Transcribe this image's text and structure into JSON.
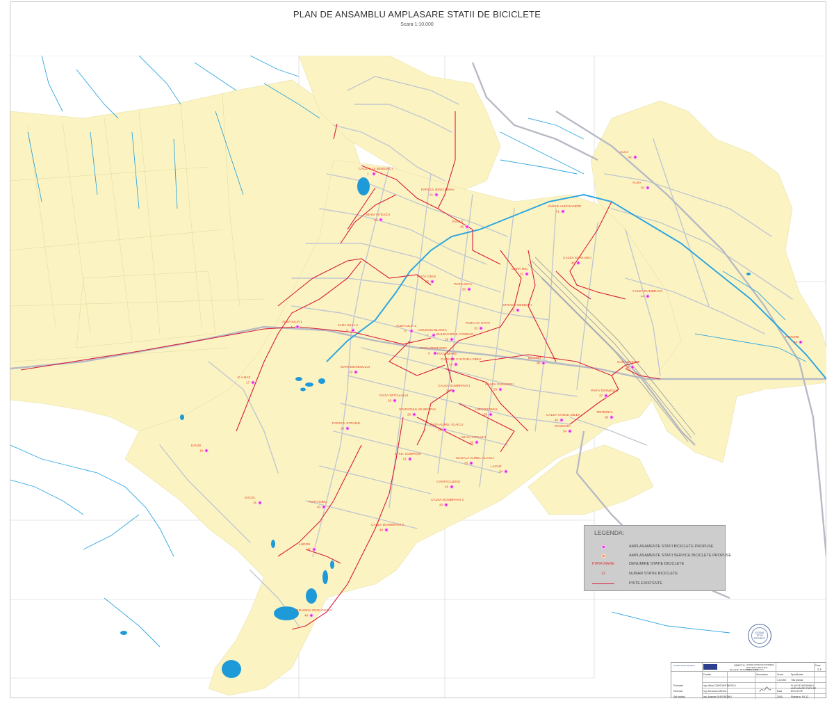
{
  "header": {
    "title": "PLAN DE ANSAMBLU AMPLASARE STATII DE BICICLETE",
    "scale": "Scara 1:10.000"
  },
  "colors": {
    "urban_area": "#fbf4c2",
    "roads": "#c2c6d0",
    "rivers": "#2fa6e0",
    "lakes": "#1e9ad8",
    "bike_lanes": "#d81b3a",
    "station_marker": "#e81ce0",
    "station_label": "#e8402a"
  },
  "stations": [
    {
      "name": "CALEA LUI BENEDICT",
      "number": "1"
    },
    {
      "name": "PARCUL BRUCKMAN",
      "number": "21"
    },
    {
      "name": "MIHAI VITEAZU",
      "number": "22"
    },
    {
      "name": "VASILE",
      "number": "26"
    },
    {
      "name": "PIATA CIBIN",
      "number": "27"
    },
    {
      "name": "PIATA MICA",
      "number": "30"
    },
    {
      "name": "GARA MIC",
      "number": "31"
    },
    {
      "name": "ALBA IULIA 2",
      "number": "3"
    },
    {
      "name": "ALBA IULIA 1",
      "number": "4"
    },
    {
      "name": "ALBA IULIA 3",
      "number": "5"
    },
    {
      "name": "COLEGIU BLOGIA",
      "number": "7"
    },
    {
      "name": "PIATA MARE",
      "number": "8"
    },
    {
      "name": "BULEVARDUL COSBUC",
      "number": "29"
    },
    {
      "name": "PIATA PRIMARIEI",
      "number": "9"
    },
    {
      "name": "CASA DE CULTURA SIBIU",
      "number": "14"
    },
    {
      "name": "PARC AC STATI",
      "number": "33"
    },
    {
      "name": "STRADA OBINETH",
      "number": "25"
    },
    {
      "name": "E.A.BAZ",
      "number": "17"
    },
    {
      "name": "MARAMURESULUI",
      "number": "16"
    },
    {
      "name": "PIATA SPITALULUI",
      "number": "28"
    },
    {
      "name": "CALEA DUMBRAVII 1",
      "number": "36"
    },
    {
      "name": "STADIONUL MUNICIPAL",
      "number": "20"
    },
    {
      "name": "HIPODROMUL",
      "number": "39"
    },
    {
      "name": "PIATA AUREL VLAICU",
      "number": "31"
    },
    {
      "name": "PARCUL STRAND",
      "number": "18"
    },
    {
      "name": "MIHAI VITEAZU",
      "number": "32"
    },
    {
      "name": "SCOALA AUREL VLAICU",
      "number": "35"
    },
    {
      "name": "DAVID",
      "number": "19"
    },
    {
      "name": "LAZAR",
      "number": "34"
    },
    {
      "name": "BILSTEF",
      "number": "36"
    },
    {
      "name": "CALEA VASILE MILEA",
      "number": "40"
    },
    {
      "name": "PIATA SIBIU",
      "number": "40"
    },
    {
      "name": "CALEA DUMBRAVII 2",
      "number": "48"
    },
    {
      "name": "CALEA DUMBRAVII 3",
      "number": "43"
    },
    {
      "name": "SACEL",
      "number": "15"
    },
    {
      "name": "LUDOS",
      "number": "47"
    },
    {
      "name": "GRADINA ZOOLOGICA",
      "number": "49"
    },
    {
      "name": "PIATA TERMOLIN",
      "number": "37"
    },
    {
      "name": "GARANCIOSA",
      "number": "38"
    },
    {
      "name": "CALEA DUMBRAVII",
      "number": "44"
    },
    {
      "name": "VASILE ALECSANDRI",
      "number": "41"
    },
    {
      "name": "CALEA SURII MICI",
      "number": "46"
    },
    {
      "name": "CANTACUZINO",
      "number": "45"
    },
    {
      "name": "C.T.D. COMPOST",
      "number": "51"
    },
    {
      "name": "CLUJ",
      "number": "42"
    },
    {
      "name": "ALBA",
      "number": "50"
    },
    {
      "name": "RASINARI",
      "number": "54"
    },
    {
      "name": "TERMINAL",
      "number": "58"
    },
    {
      "name": "PADURE",
      "number": "44"
    },
    {
      "name": "CALEA CISNADIEI",
      "number": "53"
    }
  ],
  "legend": {
    "title": "LEGENDA:",
    "items": [
      {
        "symbol": "station-proposed",
        "label": "AMPLASAMENTE STATII BICICLETE PROPUSE"
      },
      {
        "symbol": "service-proposed",
        "label": "AMPLASAMENTE STATII SERVICE BICICLETE PROPUSE"
      },
      {
        "symbol": "name",
        "symbol_text": "PIATA MARE",
        "label": "DENUMIRE STATIE BICICLETE"
      },
      {
        "symbol": "number",
        "symbol_text": "12",
        "label": "NUMAR STATIE BICICLETE"
      },
      {
        "symbol": "line",
        "label": "PISTE EXISTENTE"
      }
    ]
  },
  "stamp": {
    "text": "GLOBAL TECH PROJECT"
  },
  "titleblock": {
    "objective_label": "OBIECTIV:",
    "objective": "SISTEM AUTOMAT DE INCHIRIERE BICICLETE IN REGIM SELF - SERVICE - SIBIU CITY",
    "faza_label": "Faza",
    "faza": "S.F.",
    "beneficiar": "Beneficiar: MUNICIPIUL SIBIU",
    "specificatie": "Specificatie",
    "functie": "Functie",
    "semnatura": "Semnatura",
    "scara_label": "Scara",
    "scara": "1:10.000",
    "proiectat": "Proiectat:",
    "proiectat_nume": "ing. Mihai CONSTANTINESCU",
    "desenat": "Desenat:",
    "desenat_nume": "ing. Alexandru MINCA",
    "sef_proiect": "Sef proiect:",
    "sef_nume": "ing. Anamari GHEORGHIU",
    "data_label": "Data",
    "data": "2016",
    "titlu_label": "Titlu plansa",
    "titlu": "PLAN DE ANSAMBLU AMPLASARE STATII DE BICICLETE",
    "plansa": "Plansa nr. P4-12"
  }
}
